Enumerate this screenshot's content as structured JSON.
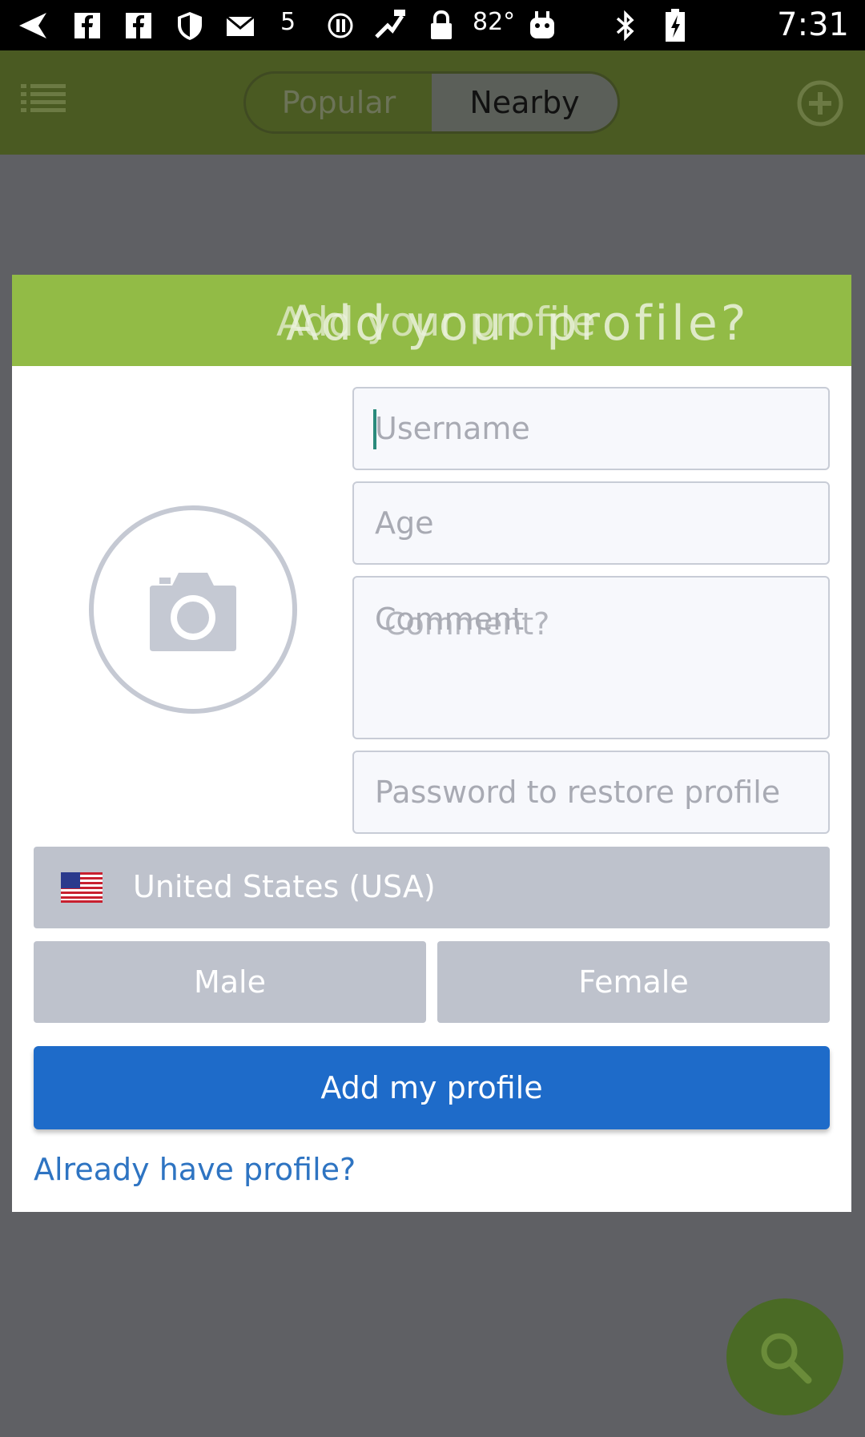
{
  "status_bar": {
    "temperature": "82°",
    "badge_5": "5",
    "time": "7:31"
  },
  "app_bar": {
    "tabs": [
      {
        "label": "Popular",
        "selected": false
      },
      {
        "label": "Nearby",
        "selected": true
      }
    ]
  },
  "dialog": {
    "title_overlay": "Add your profile",
    "title": "Add your profile?",
    "fields": {
      "username_placeholder": "Username",
      "age_placeholder": "Age",
      "comment_placeholder": "Comment",
      "comment_placeholder_overlay": "Comment?",
      "password_placeholder": "Password to restore profile"
    },
    "country": "United States (USA)",
    "gender_options": [
      "Male",
      "Female"
    ],
    "submit_label": "Add my profile",
    "already_link": "Already have profile?"
  },
  "colors": {
    "app_bar": "#4a5a22",
    "dialog_header": "#92bb46",
    "primary_button": "#1e6bc9",
    "link": "#2e74c2",
    "overlay": "#5f6064"
  },
  "icons": [
    "menu-icon",
    "add-circle-icon",
    "camera-icon",
    "us-flag-icon",
    "search-icon"
  ]
}
